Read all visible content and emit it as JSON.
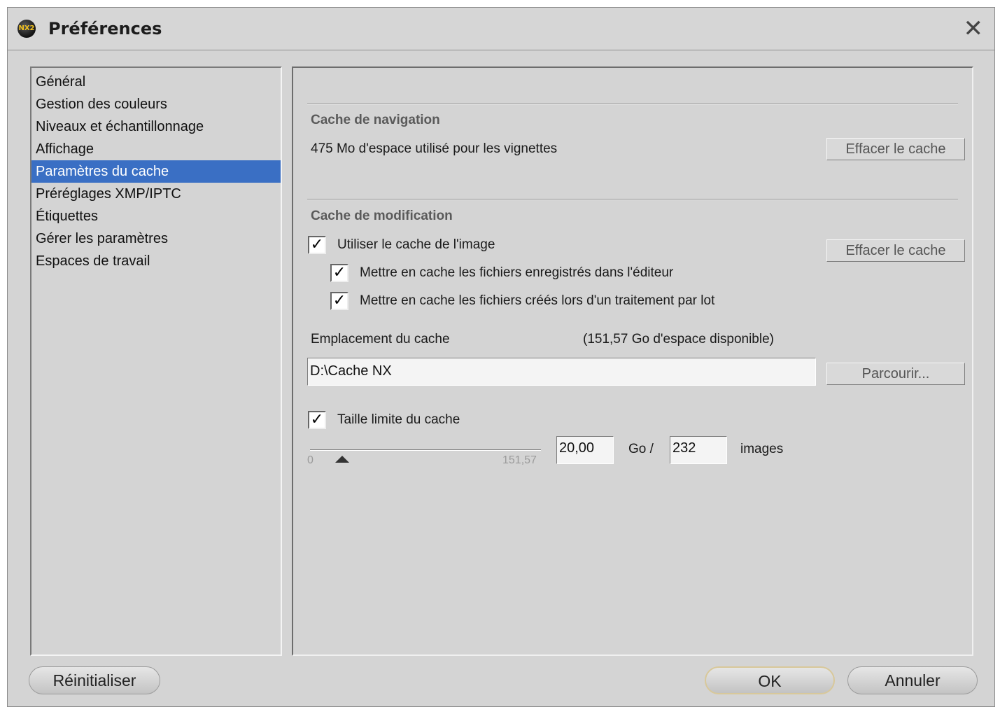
{
  "window": {
    "title": "Préférences",
    "close_glyph": "✕",
    "app_icon": "nx-app-icon",
    "app_icon_text": "NX2"
  },
  "sidebar": {
    "items": [
      {
        "label": "Général",
        "selected": false
      },
      {
        "label": "Gestion des couleurs",
        "selected": false
      },
      {
        "label": "Niveaux et échantillonnage",
        "selected": false
      },
      {
        "label": "Affichage",
        "selected": false
      },
      {
        "label": "Paramètres du cache",
        "selected": true
      },
      {
        "label": "Préréglages XMP/IPTC",
        "selected": false
      },
      {
        "label": "Étiquettes",
        "selected": false
      },
      {
        "label": "Gérer les paramètres",
        "selected": false
      },
      {
        "label": "Espaces de travail",
        "selected": false
      }
    ],
    "selection_color": "#3a6fc4"
  },
  "navigation_cache": {
    "heading": "Cache de navigation",
    "usage_text": "475 Mo d'espace utilisé pour les vignettes",
    "clear_button": "Effacer le cache"
  },
  "edit_cache": {
    "heading": "Cache de modification",
    "clear_button": "Effacer le cache",
    "use_image_cache": {
      "label": "Utiliser le cache de l'image",
      "checked": true
    },
    "cache_editor_files": {
      "label": "Mettre en cache les fichiers enregistrés dans l'éditeur",
      "checked": true
    },
    "cache_batch_files": {
      "label": "Mettre en cache les fichiers créés lors d'un traitement par lot",
      "checked": true
    },
    "location_label": "Emplacement du cache",
    "available_space": "(151,57 Go d'espace disponible)",
    "location_value": "D:\\Cache NX",
    "browse_button": "Parcourir...",
    "limit_size": {
      "label": "Taille limite du cache",
      "checked": true
    },
    "slider": {
      "min_label": "0",
      "max_label": "151,57",
      "value": 20.0,
      "min": 0,
      "max": 151.57
    },
    "size_value": "20,00",
    "size_unit": "Go /",
    "images_value": "232",
    "images_label": "images"
  },
  "footer": {
    "reset_button": "Réinitialiser",
    "ok_button": "OK",
    "cancel_button": "Annuler"
  },
  "check_glyph": "✓"
}
